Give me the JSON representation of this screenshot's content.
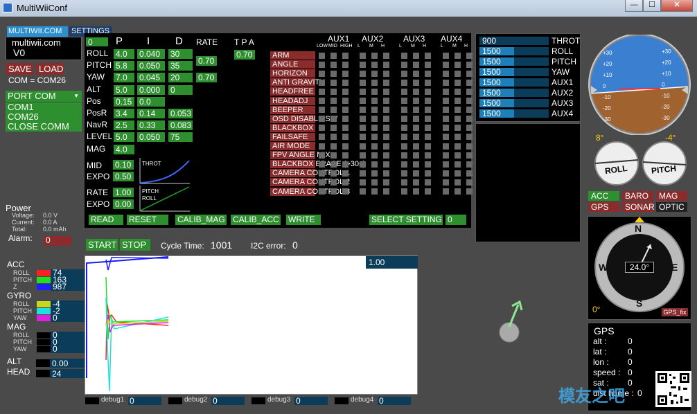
{
  "window": {
    "title": "MultiWiiConf",
    "min": "—",
    "max": "☐",
    "close": "✕"
  },
  "tabs": {
    "multiwii": "MULTIWII.COM",
    "settings": "SETTINGS"
  },
  "brand": {
    "line1": "multiwii.com",
    "line2": "V0"
  },
  "buttons": {
    "save": "SAVE",
    "load": "LOAD",
    "read": "READ",
    "reset": "RESET",
    "calib_mag": "CALIB_MAG",
    "calib_acc": "CALIB_ACC",
    "write": "WRITE",
    "select_setting": "SELECT SETTING",
    "start": "START",
    "stop": "STOP"
  },
  "com": {
    "status": "COM = COM26",
    "port_label": "PORT COM",
    "ports": [
      "COM1",
      "COM26",
      "CLOSE COMM"
    ]
  },
  "pid": {
    "headers": [
      "P",
      "I",
      "D",
      "RATE",
      "T P A"
    ],
    "top_value": "0",
    "rows": [
      {
        "name": "ROLL",
        "p": "4.0",
        "i": "0.040",
        "d": "30"
      },
      {
        "name": "PITCH",
        "p": "5.8",
        "i": "0.050",
        "d": "35"
      },
      {
        "name": "YAW",
        "p": "7.0",
        "i": "0.045",
        "d": "20"
      },
      {
        "name": "ALT",
        "p": "5.0",
        "i": "0.000",
        "d": "0"
      },
      {
        "name": "Pos",
        "p": "0.15",
        "i": "0.0",
        "d": ""
      },
      {
        "name": "PosR",
        "p": "3.4",
        "i": "0.14",
        "d": "0.053"
      },
      {
        "name": "NavR",
        "p": "2.5",
        "i": "0.33",
        "d": "0.083"
      },
      {
        "name": "LEVEL",
        "p": "5.0",
        "i": "0.050",
        "d": "75"
      },
      {
        "name": "MAG",
        "p": "4.0",
        "i": "",
        "d": ""
      }
    ],
    "rate_roll_pitch": "0.70",
    "rate_yaw": "0.70",
    "tpa": "0.70",
    "mid_label": "MID",
    "mid": "0.10",
    "expo_label": "EXPO",
    "expo": "0.50",
    "rate_label": "RATE",
    "rate": "1.00",
    "expo2_label": "EXPO",
    "expo2": "0.00",
    "curve1_label": "THROT",
    "curve2_label1": "PITCH",
    "curve2_label2": "ROLL",
    "select_value": "0"
  },
  "aux": {
    "headers": [
      "AUX1",
      "AUX2",
      "AUX3",
      "AUX4"
    ],
    "sub": [
      "LOW",
      "MID",
      "HIGH",
      "L",
      "M",
      "H",
      "L",
      "M",
      "H",
      "L",
      "M",
      "H"
    ],
    "modes": [
      "ARM",
      "ANGLE",
      "HORIZON",
      "ANTI GRAVITY",
      "HEADFREE",
      "HEADADJ",
      "BEEPER",
      "OSD DISABLE SW",
      "BLACKBOX",
      "FAILSAFE",
      "AIR MODE",
      "FPV ANGLE MIX",
      "BLACKBOX ERASE (>30s)",
      "CAMERA CONTROL 1",
      "CAMERA CONTROL 2",
      "CAMERA CONTROL 3"
    ]
  },
  "rc": [
    {
      "value": "900",
      "name": "THROT",
      "fill": 0.0
    },
    {
      "value": "1500",
      "name": "ROLL",
      "fill": 0.5
    },
    {
      "value": "1500",
      "name": "PITCH",
      "fill": 0.5
    },
    {
      "value": "1500",
      "name": "YAW",
      "fill": 0.5
    },
    {
      "value": "1500",
      "name": "AUX1",
      "fill": 0.5
    },
    {
      "value": "1500",
      "name": "AUX2",
      "fill": 0.5
    },
    {
      "value": "1500",
      "name": "AUX3",
      "fill": 0.5
    },
    {
      "value": "1500",
      "name": "AUX4",
      "fill": 0.5
    }
  ],
  "horizon": {
    "marks_left": [
      "+30",
      "+20",
      "+10",
      "0",
      "-10",
      "-20",
      "-30"
    ],
    "marks_right": [
      "+30",
      "+20",
      "+10",
      "0",
      "-10",
      "-20",
      "-30"
    ],
    "roll_angle": "8°",
    "pitch_angle": "-4°",
    "roll_label": "ROLL",
    "pitch_label": "PITCH"
  },
  "sensors": {
    "acc": "ACC",
    "baro": "BARO",
    "mag": "MAG",
    "gps": "GPS",
    "sonar": "SONAR",
    "optic": "OPTIC"
  },
  "compass": {
    "n": "N",
    "s": "S",
    "e": "E",
    "w": "W",
    "heading": "24.0°",
    "alt_angle": "0°",
    "gps_fix": "GPS_fix"
  },
  "gps": {
    "title": "GPS",
    "fields": [
      {
        "k": "alt :",
        "v": "0"
      },
      {
        "k": "lat :",
        "v": "0"
      },
      {
        "k": "lon :",
        "v": "0"
      },
      {
        "k": "speed :",
        "v": "0"
      },
      {
        "k": "sat :",
        "v": "0"
      },
      {
        "k": "dist home :",
        "v": "0"
      }
    ]
  },
  "power": {
    "title": "Power",
    "voltage_label": "Voltage:",
    "voltage": "0.0 V",
    "current_label": "Current:",
    "current": "0.0 A",
    "total_label": "Total:",
    "total": "0.0 mAh",
    "alarm_label": "Alarm:",
    "alarm": "0"
  },
  "imu": {
    "acc_title": "ACC",
    "acc": [
      {
        "k": "ROLL",
        "v": "74",
        "c": "#ff2020"
      },
      {
        "k": "PITCH",
        "v": "163",
        "c": "#20e020"
      },
      {
        "k": "Z",
        "v": "987",
        "c": "#2020ff"
      }
    ],
    "gyro_title": "GYRO",
    "gyro": [
      {
        "k": "ROLL",
        "v": "-4",
        "c": "#c8d820"
      },
      {
        "k": "PITCH",
        "v": "-2",
        "c": "#20e0e0"
      },
      {
        "k": "YAW",
        "v": "0",
        "c": "#e020e0"
      }
    ],
    "mag_title": "MAG",
    "mag": [
      {
        "k": "ROLL",
        "v": "0"
      },
      {
        "k": "PITCH",
        "v": "0"
      },
      {
        "k": "YAW",
        "v": "0"
      }
    ],
    "alt_title": "ALT",
    "alt": "0.00",
    "head_title": "HEAD",
    "head": "24"
  },
  "status": {
    "cycle_label": "Cycle Time:",
    "cycle": "1001",
    "i2c_label": "I2C error:",
    "i2c": "0",
    "graph_scale": "1.00"
  },
  "debug": [
    {
      "k": "debug1",
      "v": "0"
    },
    {
      "k": "debug2",
      "v": "0"
    },
    {
      "k": "debug3",
      "v": "0"
    },
    {
      "k": "debug4",
      "v": "0"
    }
  ],
  "watermark": "模友之吧",
  "colors": {
    "green": "#2d8f2d",
    "red": "#8b2c2c",
    "sky": "#3b7fd0",
    "ground": "#a0622e"
  }
}
